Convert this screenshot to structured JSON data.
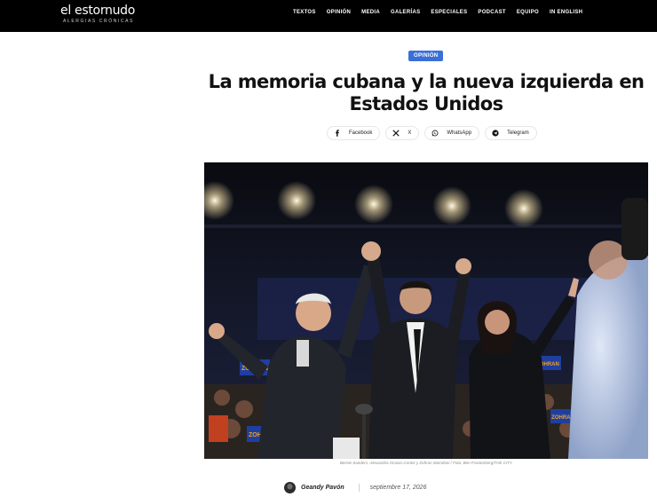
{
  "brand": {
    "name": "el estornudo",
    "tagline": "ALERGIAS CRÓNICAS"
  },
  "nav": {
    "items": [
      "TEXTOS",
      "OPINIÓN",
      "MEDIA",
      "GALERÍAS",
      "ESPECIALES",
      "PODCAST",
      "EQUIPO",
      "IN ENGLISH"
    ]
  },
  "article": {
    "category": "OPINIÓN",
    "title": "La memoria cubana y la nueva izquierda en Estados Unidos",
    "image_caption": "Bernie Sanders, Alexandria Ocasio-Cortez y Zohran Mamdani / Foto: Ben Fractenberg/THE CITY",
    "signs": [
      "ZOHRAN",
      "ZOHRAN",
      "ZOHRAN",
      "ZOHRAN"
    ],
    "author": "Geandy Pavón",
    "date": "septiembre 17, 2026"
  },
  "share": {
    "facebook": "Facebook",
    "x": "X",
    "whatsapp": "WhatsApp",
    "telegram": "Telegram"
  },
  "icons": [
    "facebook-icon",
    "x-icon",
    "whatsapp-icon",
    "telegram-icon"
  ],
  "colors": {
    "topbar": "#000000",
    "category_pill": "#3a6fd8",
    "sign_blue": "#1f3fa0",
    "sign_orange": "#f0a020"
  }
}
